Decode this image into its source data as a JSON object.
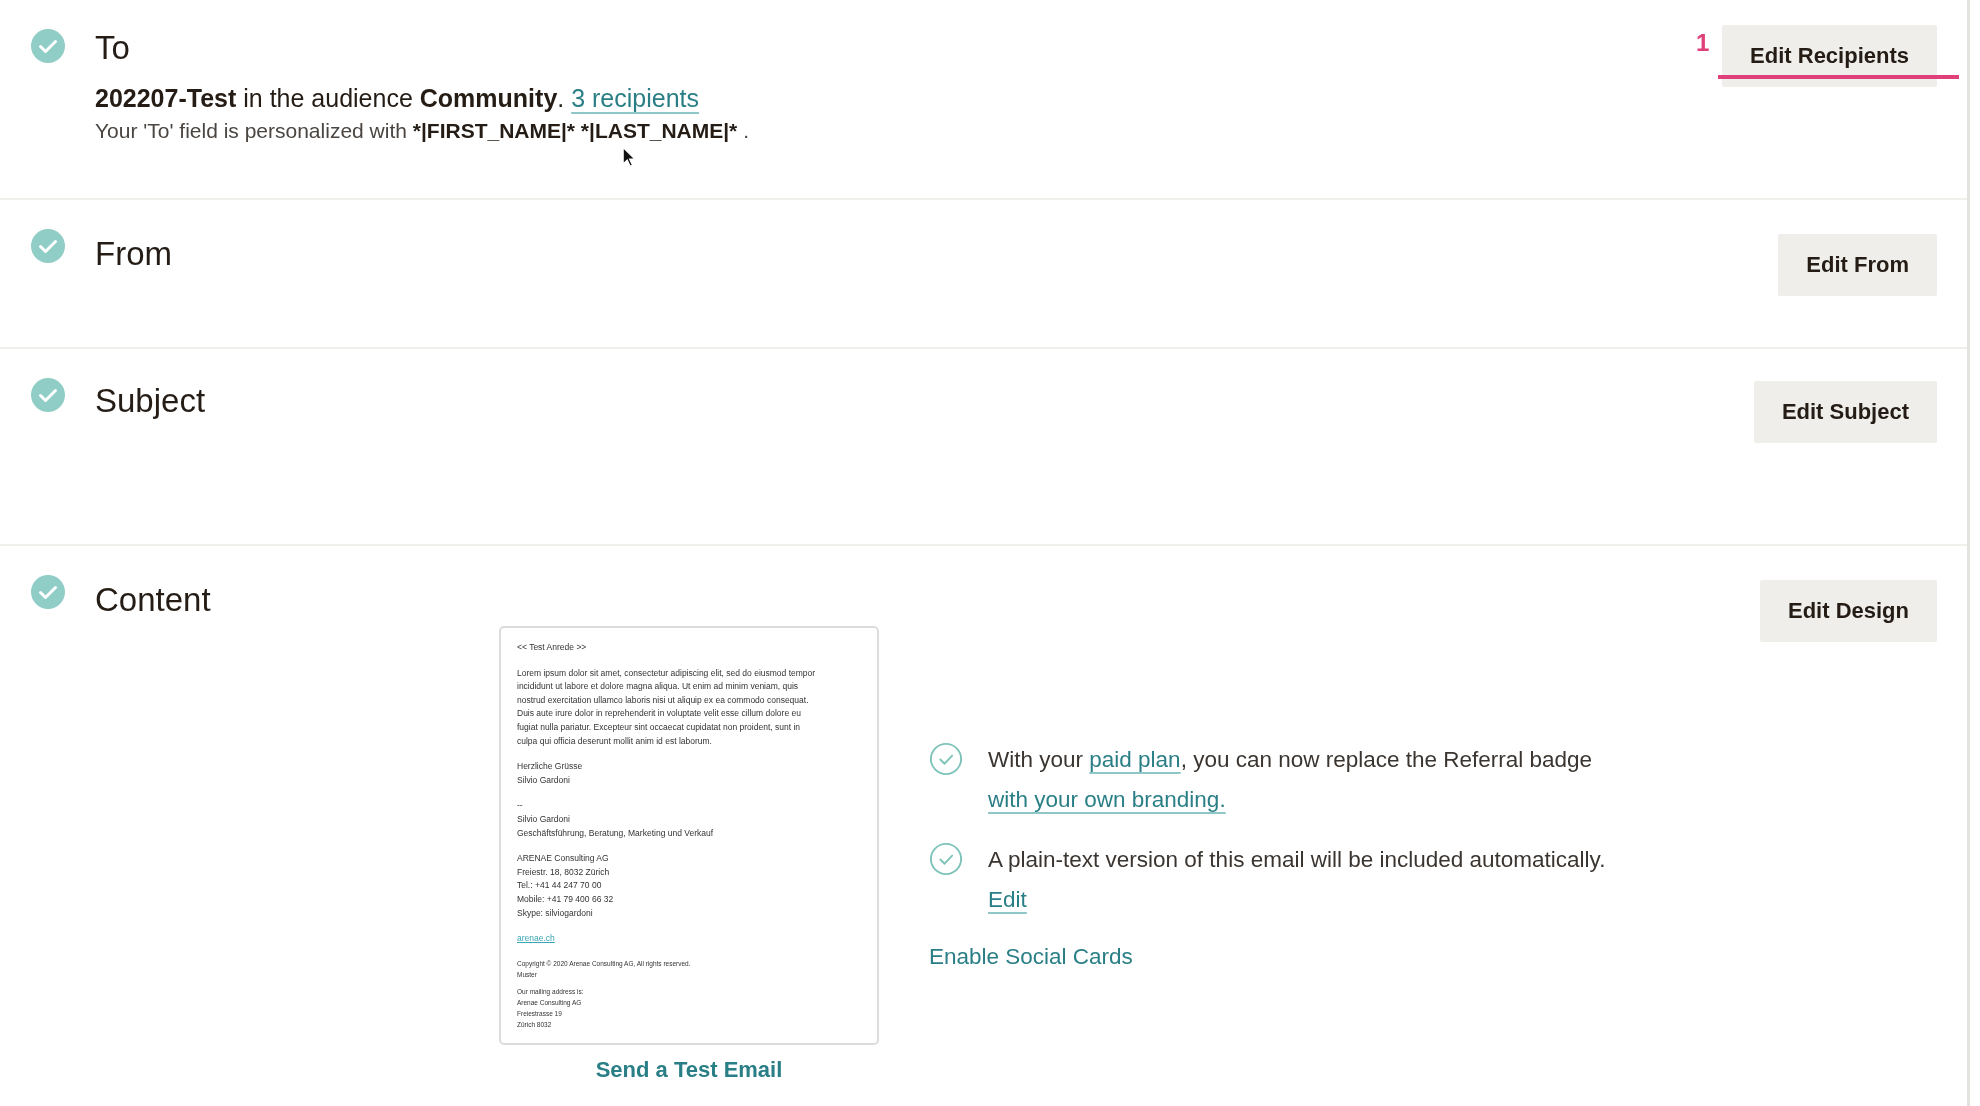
{
  "cursor": true,
  "sections": [
    {
      "kind": "to",
      "title": "To",
      "complete": true,
      "button": "Edit Recipients",
      "annotation": "1",
      "summary": "**202207-Test** in the audience **Community**.",
      "summary_link": "3 recipients",
      "note": "Your 'To' field is personalized with",
      "merge_tags": "*|FIRST_NAME|* *|LAST_NAME|*",
      "note_end": "."
    },
    {
      "kind": "from",
      "title": "From",
      "complete": true,
      "button": "Edit From"
    },
    {
      "kind": "subject",
      "title": "Subject",
      "complete": true,
      "button": "Edit Subject"
    },
    {
      "kind": "content",
      "title": "Content",
      "complete": true,
      "button": "Edit Design",
      "preview": [
        {
          "kind": "body",
          "lines": [
            "<< Test Anrede >>"
          ]
        },
        {
          "kind": "body",
          "lines": [
            "Lorem ipsum dolor sit amet, consectetur adipiscing elit, sed do eiusmod tempor",
            "incididunt ut labore et dolore magna aliqua. Ut enim ad minim veniam, quis",
            "nostrud exercitation ullamco laboris nisi ut aliquip ex ea commodo consequat.",
            "Duis aute irure dolor in reprehenderit in voluptate velit esse cillum dolore eu",
            "fugiat nulla pariatur. Excepteur sint occaecat cupidatat non proident, sunt in",
            "culpa qui officia deserunt mollit anim id est laborum."
          ]
        },
        {
          "kind": "body",
          "lines": [
            "Herzliche Grüsse",
            "Silvio Gardoni"
          ]
        },
        {
          "kind": "body",
          "lines": [
            "--",
            "Silvio Gardoni",
            "Geschäftsführung, Beratung, Marketing und Verkauf"
          ]
        },
        {
          "kind": "body",
          "lines": [
            "ARENAE Consulting AG",
            "Freiestr. 18, 8032 Zürich",
            "Tel.: +41 44 247 70 00",
            "Mobile: +41 79 400 66 32",
            "Skype: silviogardoni"
          ]
        },
        {
          "kind": "link",
          "lines": [
            "arenae.ch"
          ]
        },
        {
          "kind": "fine",
          "lines": [
            "Copyright © 2020 Arenae Consulting AG, All rights reserved.",
            "Muster"
          ]
        },
        {
          "kind": "fine",
          "lines": [
            "Our mailing address is:",
            "Arenae Consulting AG",
            "Freiestrasse 19",
            "Zürich 8032"
          ]
        }
      ],
      "test_link": "Send a Test Email",
      "notes": [
        {
          "lines": [
            [
              {
                "text": "With your "
              },
              {
                "text": "paid plan",
                "link": true
              },
              {
                "text": ", you can now replace the Referral badge"
              }
            ],
            [
              {
                "text": "with your own branding.",
                "link": true
              }
            ]
          ]
        },
        {
          "lines": [
            [
              {
                "text": "A plain-text version of this email will be included automatically."
              }
            ],
            [
              {
                "text": "Edit",
                "link": true
              }
            ]
          ]
        }
      ],
      "extra_link": "Enable Social Cards"
    }
  ]
}
